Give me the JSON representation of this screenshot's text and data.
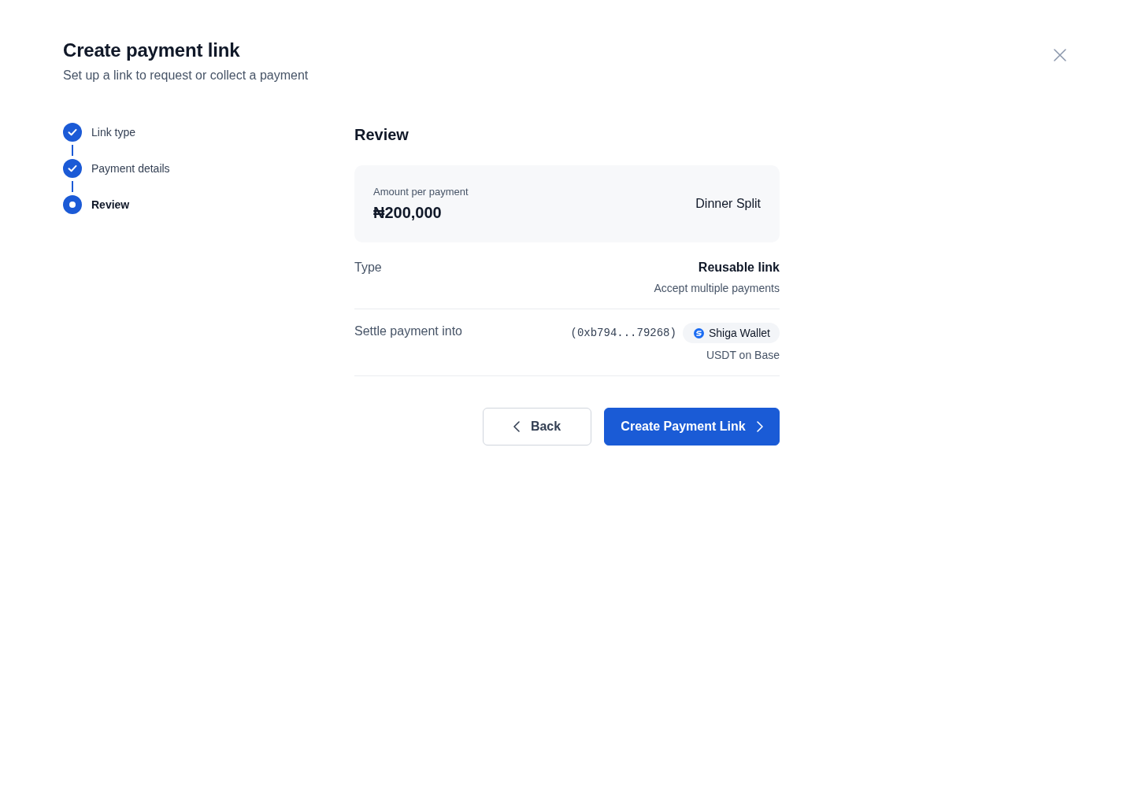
{
  "dialog": {
    "title": "Create payment link",
    "subtitle": "Set up a link to request or collect a payment"
  },
  "steps": [
    {
      "label": "Link type",
      "completed": true,
      "selected": false
    },
    {
      "label": "Payment details",
      "completed": true,
      "selected": false
    },
    {
      "label": "Review",
      "completed": false,
      "selected": true
    }
  ],
  "review": {
    "heading": "Review",
    "summary": {
      "amount_label": "Amount per payment",
      "amount": "₦200,000",
      "name": "Dinner Split"
    },
    "rows": [
      {
        "kind": "text",
        "label": "Type",
        "value": "Reusable link",
        "note": "Accept multiple payments"
      },
      {
        "kind": "wallet",
        "label": "Settle payment into",
        "address": "(0xb794...79268)",
        "wallet": "Shiga Wallet",
        "note": "USDT on Base"
      }
    ]
  },
  "buttons": {
    "back": "Back",
    "create": "Create Payment Link"
  }
}
